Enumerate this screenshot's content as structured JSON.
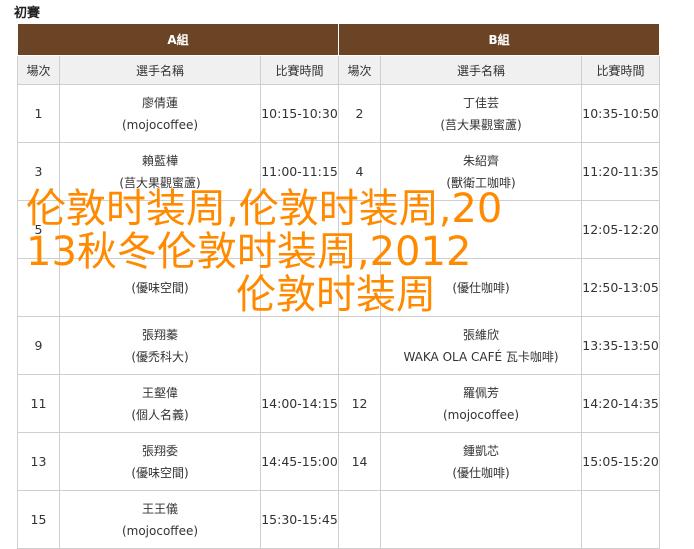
{
  "page": {
    "title": "初賽"
  },
  "table": {
    "groups": [
      "A組",
      "B組"
    ],
    "headers": [
      "場次",
      "選手名稱",
      "比賽時間",
      "場次",
      "選手名稱",
      "比賽時間"
    ],
    "rows": [
      {
        "a": {
          "round": "1",
          "name": "廖倩蓮",
          "team": "(mojocoffee)",
          "time": "10:15-10:30"
        },
        "b": {
          "round": "2",
          "name": "丁佳芸",
          "team": "(莒大果觀蜜蘆)",
          "time": "10:35-10:50"
        }
      },
      {
        "a": {
          "round": "3",
          "name": "賴藍樺",
          "team": "(莒大果觀蜜蘆)",
          "time": "11:00-11:15"
        },
        "b": {
          "round": "4",
          "name": "朱紹齊",
          "team": "(獸衛工咖啡)",
          "time": "11:20-11:35"
        }
      },
      {
        "a": {
          "round": "5",
          "name": "",
          "team": "",
          "time": ""
        },
        "b": {
          "round": "",
          "name": "",
          "team": "",
          "time": "12:05-12:20"
        }
      },
      {
        "a": {
          "round": "",
          "name": "",
          "team": "(優味空間)",
          "time": ""
        },
        "b": {
          "round": "",
          "name": "",
          "team": "(優仕咖啡)",
          "time": "12:50-13:05"
        }
      },
      {
        "a": {
          "round": "9",
          "name": "張翔蓁",
          "team": "(優禿科大)",
          "time": ""
        },
        "b": {
          "round": "",
          "name": "張維欣",
          "team": "WAKA OLA CAFÉ 瓦卡咖啡)",
          "time": "13:35-13:50"
        }
      },
      {
        "a": {
          "round": "11",
          "name": "王壑偉",
          "team": "(個人名義)",
          "time": "14:00-14:15"
        },
        "b": {
          "round": "12",
          "name": "羅佩芳",
          "team": "(mojocoffee)",
          "time": "14:20-14:35"
        }
      },
      {
        "a": {
          "round": "13",
          "name": "張翔委",
          "team": "(優味空間)",
          "time": "14:45-15:00"
        },
        "b": {
          "round": "14",
          "name": "鍾凱芯",
          "team": "(優仕咖啡)",
          "time": "15:05-15:20"
        }
      },
      {
        "a": {
          "round": "15",
          "name": "王王儀",
          "team": "(mojocoffee)",
          "time": "15:30-15:45"
        },
        "b": {
          "round": "",
          "name": "",
          "team": "",
          "time": ""
        }
      }
    ]
  },
  "overlay": {
    "line1": "伦敦时装周,伦敦时装周,20",
    "line2": "13秋冬伦敦时装周,2012",
    "line3": "伦敦时装周",
    "color": "#ff8a00"
  },
  "colors": {
    "group_header_bg": "#6b4426",
    "column_header_bg": "#f0f0f0",
    "border": "#cfcfcf"
  }
}
